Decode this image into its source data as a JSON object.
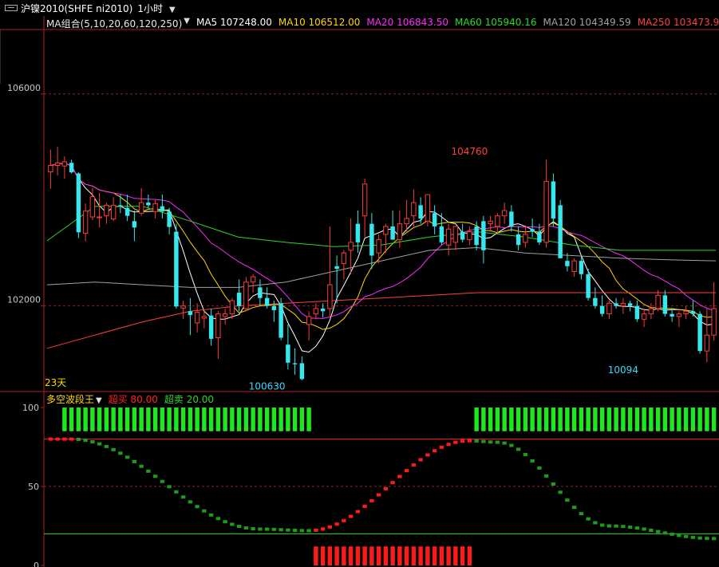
{
  "window": {
    "symbol_title": "沪镍2010(SHFE ni2010)",
    "period": "1小时"
  },
  "ma_legend": [
    {
      "label": "MA组合(5,10,20,60,120,250)",
      "color": "#e8e8e8"
    },
    {
      "label": "MA5 107248.00",
      "color": "#ffffff"
    },
    {
      "label": "MA10 106512.00",
      "color": "#ffd700"
    },
    {
      "label": "MA20 106843.50",
      "color": "#ff2bff"
    },
    {
      "label": "MA60 105940.16",
      "color": "#2bd72b"
    },
    {
      "label": "MA120 104349.59",
      "color": "#a0a0a0"
    },
    {
      "label": "MA250 103473.96",
      "color": "#ff4040"
    }
  ],
  "osc_legend": {
    "name": "多空波段王",
    "name_color": "#ffd700",
    "overbuy": "超买 80.00",
    "overbuy_color": "#ff2020",
    "oversell": "超卖 20.00",
    "oversell_color": "#2bd72b"
  },
  "chart_data": [
    {
      "type": "candlestick",
      "y_ticks": [
        "106000",
        "102000"
      ],
      "ylim": [
        100400,
        107200
      ],
      "annotations": [
        {
          "text": "104760",
          "value": 104760,
          "index": 60,
          "color": "#ff4040"
        },
        {
          "text": "100630",
          "value": 100630,
          "index": 31,
          "color": "#35d8ff"
        },
        {
          "text": "10094",
          "value": 100940,
          "index": 82,
          "color": "#35d8ff"
        },
        {
          "text": "23天",
          "color": "#ffd700"
        }
      ],
      "candles": [
        [
          104530,
          104950,
          104210,
          104650
        ],
        [
          104650,
          105000,
          104460,
          104700
        ],
        [
          104640,
          104820,
          104400,
          104720
        ],
        [
          104700,
          104760,
          104500,
          104520
        ],
        [
          104500,
          104520,
          103280,
          103390
        ],
        [
          103370,
          103930,
          103220,
          103790
        ],
        [
          103680,
          104230,
          103620,
          104060
        ],
        [
          103680,
          104130,
          103480,
          103680
        ],
        [
          103700,
          103950,
          103550,
          103900
        ],
        [
          103640,
          104050,
          103600,
          103900
        ],
        [
          103900,
          104100,
          103750,
          103880
        ],
        [
          103850,
          104100,
          103600,
          103700
        ],
        [
          103600,
          103800,
          103220,
          103480
        ],
        [
          103750,
          104220,
          103700,
          103950
        ],
        [
          103950,
          104100,
          103850,
          103900
        ],
        [
          103780,
          104000,
          103650,
          103930
        ],
        [
          103880,
          104100,
          103650,
          103780
        ],
        [
          103780,
          103850,
          103350,
          103490
        ],
        [
          103400,
          103550,
          101950,
          101990
        ],
        [
          101960,
          102100,
          101750,
          102000
        ],
        [
          101900,
          102150,
          101450,
          101830
        ],
        [
          101680,
          102050,
          101500,
          101880
        ],
        [
          101770,
          101900,
          101580,
          101800
        ],
        [
          101820,
          101950,
          101250,
          101380
        ],
        [
          101400,
          101900,
          101000,
          101850
        ],
        [
          101800,
          101950,
          101650,
          101850
        ],
        [
          101850,
          102150,
          101750,
          102100
        ],
        [
          102250,
          102500,
          101900,
          102000
        ],
        [
          101950,
          102550,
          101900,
          102450
        ],
        [
          102450,
          102600,
          102250,
          102550
        ],
        [
          102350,
          102500,
          102000,
          102150
        ],
        [
          102150,
          102350,
          101950,
          102000
        ],
        [
          102000,
          102100,
          101700,
          101920
        ],
        [
          102050,
          102150,
          101350,
          101400
        ],
        [
          101270,
          101650,
          100800,
          100930
        ],
        [
          100920,
          101200,
          100700,
          100900
        ],
        [
          100920,
          101050,
          100600,
          100620
        ],
        [
          101650,
          101900,
          101350,
          101800
        ],
        [
          101850,
          102050,
          101750,
          101950
        ],
        [
          101950,
          102050,
          101780,
          101900
        ],
        [
          101950,
          103500,
          101800,
          102400
        ],
        [
          102750,
          102950,
          102050,
          102700
        ],
        [
          102800,
          103050,
          102500,
          103000
        ],
        [
          103050,
          103650,
          102600,
          103200
        ],
        [
          103550,
          103800,
          103000,
          103200
        ],
        [
          103700,
          104400,
          103300,
          104300
        ],
        [
          103550,
          103750,
          102700,
          102950
        ],
        [
          103000,
          103350,
          102800,
          103250
        ],
        [
          103350,
          103550,
          103000,
          103500
        ],
        [
          103500,
          103800,
          103250,
          103250
        ],
        [
          103250,
          103800,
          103100,
          103550
        ],
        [
          103550,
          104000,
          103400,
          103650
        ],
        [
          103700,
          104200,
          103500,
          103950
        ],
        [
          103900,
          104050,
          103550,
          103650
        ],
        [
          103600,
          104100,
          103500,
          104100
        ],
        [
          103750,
          103900,
          103350,
          103500
        ],
        [
          103500,
          103750,
          103150,
          103200
        ],
        [
          103150,
          103550,
          102950,
          103450
        ],
        [
          103200,
          103500,
          103050,
          103500
        ],
        [
          103400,
          103550,
          103200,
          103250
        ],
        [
          103250,
          103500,
          103150,
          103400
        ],
        [
          103500,
          103600,
          103050,
          103150
        ],
        [
          103600,
          103700,
          102800,
          103050
        ],
        [
          103550,
          103700,
          103400,
          103600
        ],
        [
          103500,
          103750,
          103350,
          103700
        ],
        [
          103700,
          103950,
          103550,
          103800
        ],
        [
          103780,
          103900,
          103400,
          103500
        ],
        [
          103350,
          103500,
          103050,
          103150
        ],
        [
          103200,
          103500,
          103100,
          103350
        ],
        [
          103450,
          103650,
          103300,
          103400
        ],
        [
          103400,
          103550,
          103150,
          103200
        ],
        [
          103200,
          104760,
          103100,
          104350
        ],
        [
          104350,
          104500,
          103500,
          103650
        ],
        [
          103900,
          104000,
          102900,
          102900
        ],
        [
          102850,
          103000,
          102650,
          102750
        ],
        [
          102650,
          102900,
          102550,
          102850
        ],
        [
          102850,
          102950,
          102500,
          102600
        ],
        [
          102600,
          102700,
          102100,
          102150
        ],
        [
          102150,
          102350,
          101950,
          102000
        ],
        [
          102000,
          102200,
          101800,
          101850
        ],
        [
          101850,
          102100,
          101750,
          102050
        ],
        [
          102050,
          102150,
          101950,
          102000
        ],
        [
          102000,
          102150,
          101850,
          102050
        ],
        [
          102050,
          102100,
          101900,
          102000
        ],
        [
          102000,
          102100,
          101700,
          101750
        ],
        [
          101750,
          101950,
          101600,
          101850
        ],
        [
          101850,
          102050,
          101750,
          101950
        ],
        [
          101950,
          102300,
          101900,
          102200
        ],
        [
          102200,
          102300,
          101800,
          101850
        ],
        [
          101850,
          101950,
          101700,
          101800
        ],
        [
          101800,
          101900,
          101600,
          101850
        ],
        [
          101850,
          102000,
          101750,
          101900
        ],
        [
          101900,
          102100,
          101800,
          101850
        ],
        [
          101850,
          101900,
          101100,
          101150
        ],
        [
          101150,
          101950,
          100940,
          101450
        ],
        [
          101450,
          102450,
          101350,
          101950
        ]
      ]
    },
    {
      "type": "indicator",
      "name": "多空波段王",
      "y_ticks": [
        "100",
        "50",
        "0"
      ],
      "ylim": [
        0,
        100
      ],
      "overbuy_level": 80,
      "oversell_level": 20
    }
  ]
}
